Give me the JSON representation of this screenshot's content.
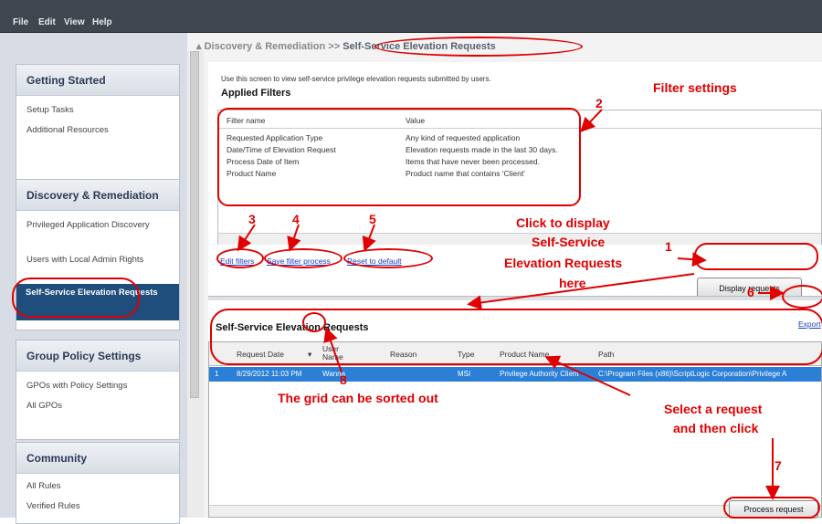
{
  "menu": [
    "File",
    "Edit",
    "View",
    "Help"
  ],
  "breadcrumb": {
    "parent": "Discovery & Remediation",
    "sep": ">>",
    "current": "Self-Service Elevation Requests"
  },
  "sidebar": {
    "getting_started": {
      "title": "Getting Started",
      "items": [
        "Setup Tasks",
        "Additional Resources"
      ]
    },
    "discovery": {
      "title": "Discovery & Remediation",
      "items": [
        "Privileged Application Discovery",
        "Users with Local Admin Rights",
        "Self-Service Elevation Requests"
      ]
    },
    "gpo": {
      "title": "Group Policy Settings",
      "items": [
        "GPOs with Policy Settings",
        "All GPOs"
      ]
    },
    "community": {
      "title": "Community",
      "items": [
        "All Rules",
        "Verified Rules"
      ]
    }
  },
  "content": {
    "description": "Use this screen to view self-service privilege elevation requests submitted by users.",
    "applied_filters_title": "Applied Filters",
    "filter_columns": [
      "Filter name",
      "Value"
    ],
    "filters": [
      [
        "Requested Application Type",
        "Any kind of requested application"
      ],
      [
        "Date/Time of Elevation Request",
        "Elevation requests made in the last 30 days."
      ],
      [
        "Process Date of Item",
        "Items that have never been processed."
      ],
      [
        "Product Name",
        "Product name that contains 'Client'"
      ]
    ],
    "links": {
      "edit": "Edit filters",
      "save": "Save filter process",
      "reset": "Reset to default"
    },
    "display_button": "Display requests",
    "grid_title": "Self-Service Elevation Requests",
    "export_label": "Export",
    "columns": [
      "Request Date",
      "User Name",
      "Reason",
      "Type",
      "Product Name",
      "Path"
    ],
    "rows": [
      [
        "1",
        "8/29/2012 11:03 PM",
        "Wanna",
        "",
        "MSI",
        "Privilege Authority Client",
        "C:\\Program Files (x86)\\ScriptLogic Corporation\\Privilege A"
      ]
    ],
    "process_button": "Process request"
  },
  "annotations": {
    "n1": "1",
    "n2": "2",
    "n3": "3",
    "n4": "4",
    "n5": "5",
    "n6": "6",
    "n7": "7",
    "n8": "8",
    "filter_settings": "Filter settings",
    "click_display": "Click to display",
    "self_service": "Self-Service",
    "elevation": "Elevation Requests",
    "here": "here",
    "grid_sorted": "The grid can be sorted out",
    "select_request": "Select a request",
    "and_click": "and then click"
  },
  "colors": {
    "annotation": "#e00000",
    "selection": "#2b7fd6",
    "sidebar_selected": "#1f4d7c"
  }
}
